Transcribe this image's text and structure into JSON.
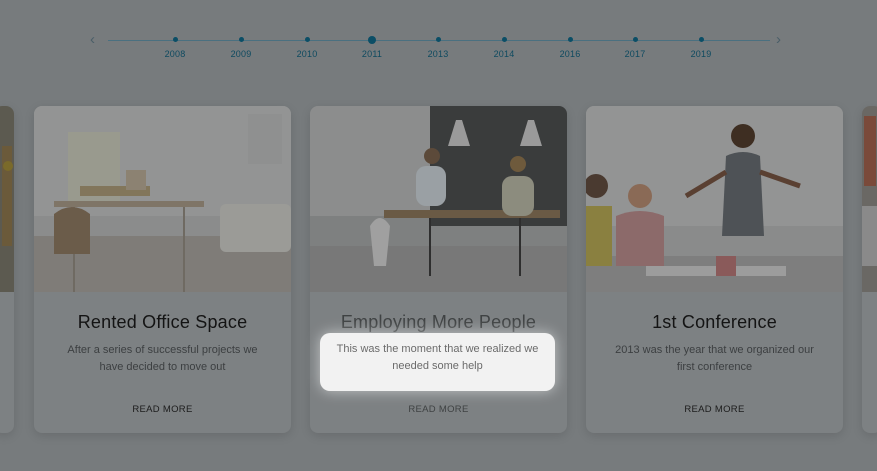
{
  "timeline": {
    "prev_icon": "chevron-left-icon",
    "next_icon": "chevron-right-icon",
    "prev_glyph": "‹",
    "next_glyph": "›",
    "years": [
      "2008",
      "2009",
      "2010",
      "2011",
      "2013",
      "2014",
      "2016",
      "2017",
      "2019"
    ],
    "active_year": "2011"
  },
  "cards": [
    {
      "title": "Rented Office Space",
      "text": "After a series of successful projects we have decided to move out",
      "link": "READ MORE"
    },
    {
      "title": "Employing More People",
      "text": "This was the moment that we realized we needed some help",
      "link": "READ MORE"
    },
    {
      "title": "1st Conference",
      "text": "2013 was the year that we organized our first conference",
      "link": "READ MORE"
    }
  ],
  "colors": {
    "overlay": "#777b7d",
    "timeline_accent": "#0b4e66",
    "spotlight": "#f2f2f2"
  }
}
